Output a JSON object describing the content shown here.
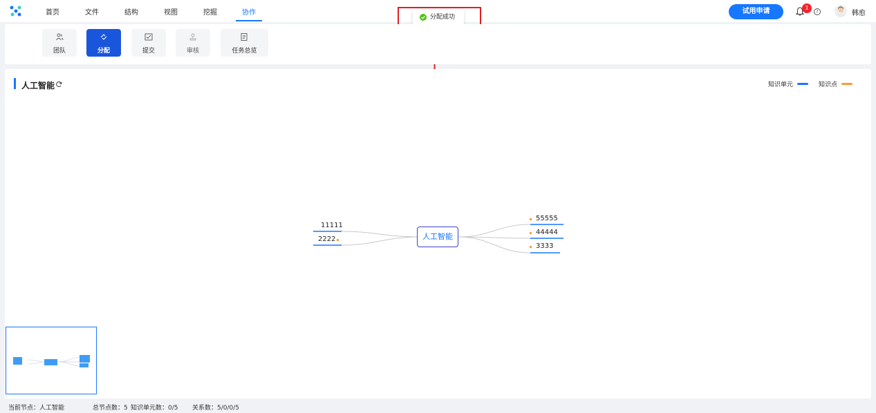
{
  "nav": {
    "items": [
      "首页",
      "文件",
      "结构",
      "视图",
      "挖掘",
      "协作"
    ],
    "active_index": 5,
    "trial_button": "试用申请",
    "notification_count": "1",
    "help_symbol": "?",
    "username": "韩愈"
  },
  "toast": {
    "message": "分配成功"
  },
  "toolbar": {
    "tools": [
      {
        "label": "团队",
        "icon": "users-icon",
        "state": "normal"
      },
      {
        "label": "分配",
        "icon": "share-icon",
        "state": "active"
      },
      {
        "label": "提交",
        "icon": "check-square-icon",
        "state": "normal"
      },
      {
        "label": "审核",
        "icon": "stamp-icon",
        "state": "disabled"
      },
      {
        "label": "任务总览",
        "icon": "document-icon",
        "state": "normal"
      }
    ]
  },
  "main": {
    "title": "人工智能",
    "legend": [
      {
        "label": "知识单元",
        "color": "#1677ff"
      },
      {
        "label": "知识点",
        "color": "#ff9a2e"
      }
    ],
    "mindmap": {
      "root": "人工智能",
      "left_nodes": [
        "11111",
        "2222"
      ],
      "right_nodes": [
        "55555",
        "44444",
        "3333"
      ]
    }
  },
  "status_bar": {
    "current_node": "当前节点：人工智能",
    "total_nodes": "总节点数：5",
    "knowledge_units": "知识单元数：0/5",
    "relations": "关系数：5/0/0/5"
  },
  "colors": {
    "accent": "#1677ff",
    "active_tool": "#1a56db",
    "highlight": "#e01f1f",
    "success": "#52c41a",
    "badge": "#f5222d",
    "knowledge_point": "#ff9a2e"
  }
}
